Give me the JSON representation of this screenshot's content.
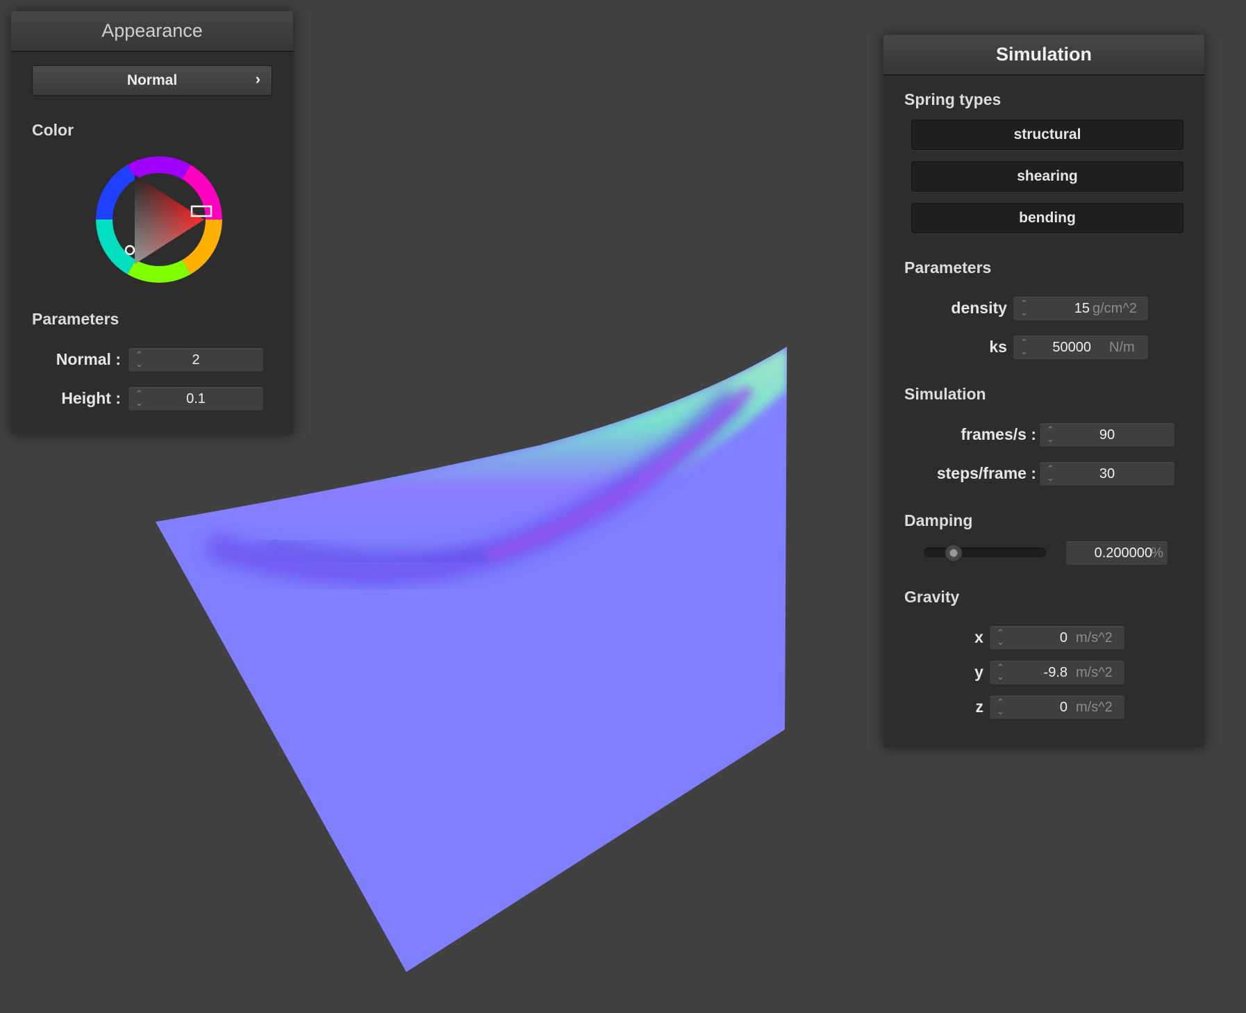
{
  "appearance": {
    "title": "Appearance",
    "mode_button": "Normal",
    "mode_chevron": "›",
    "color_label": "Color",
    "params_label": "Parameters",
    "normal_label": "Normal :",
    "normal_value": "2",
    "height_label": "Height :",
    "height_value": "0.1",
    "selected_color": "#ff0000"
  },
  "simulation": {
    "title": "Simulation",
    "spring_types_label": "Spring types",
    "spring_buttons": [
      "structural",
      "shearing",
      "bending"
    ],
    "params_label": "Parameters",
    "density_label": "density :",
    "density_value": "15",
    "density_unit": "g/cm^2",
    "ks_label": "ks :",
    "ks_value": "50000",
    "ks_unit": "N/m",
    "sim_label": "Simulation",
    "fps_label": "frames/s :",
    "fps_value": "90",
    "steps_label": "steps/frame :",
    "steps_value": "30",
    "damping_label": "Damping",
    "damping_value": "0.200000",
    "damping_unit": "%",
    "damping_slider_fraction": 0.2,
    "gravity_label": "Gravity",
    "gx_label": "x :",
    "gx_value": "0",
    "gy_label": "y :",
    "gy_value": "-9.8",
    "gz_label": "z :",
    "gz_value": "0",
    "gravity_unit": "m/s^2"
  },
  "icons": {
    "spin_arrows": "⌃⌄"
  },
  "colors": {
    "background": "#414141",
    "cloth": "#8080ff"
  }
}
